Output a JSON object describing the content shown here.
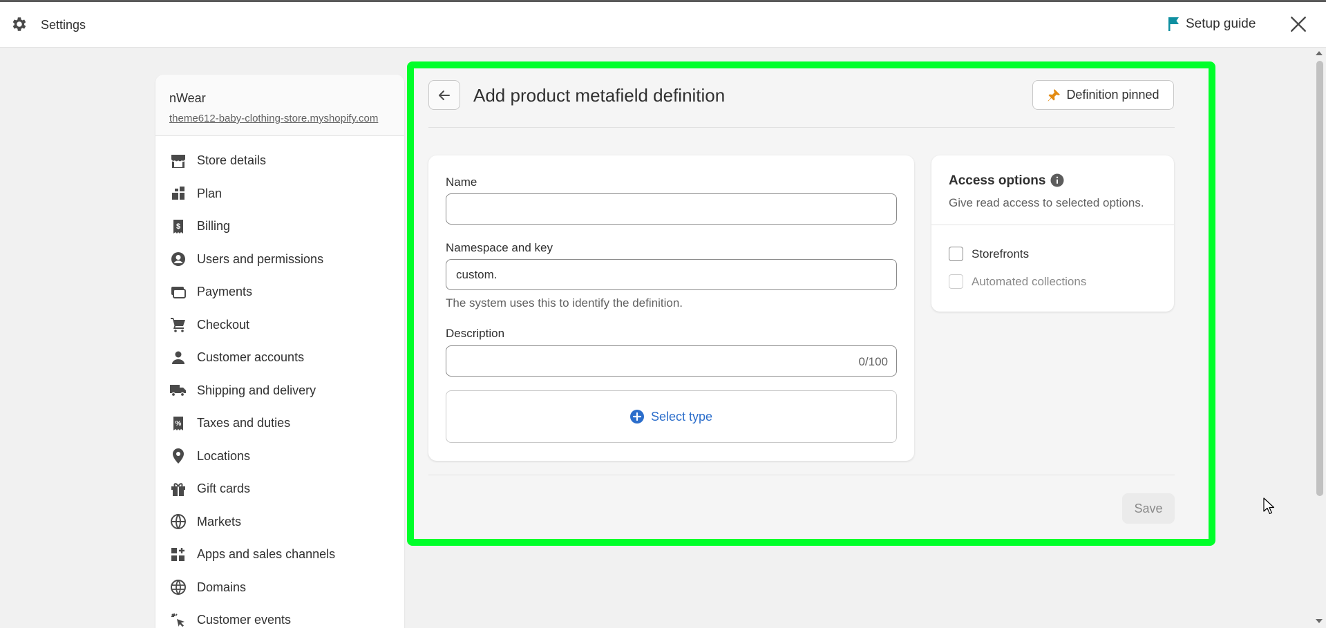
{
  "topbar": {
    "title": "Settings",
    "setup_guide_label": "Setup guide"
  },
  "store": {
    "name": "nWear",
    "url": "theme612-baby-clothing-store.myshopify.com"
  },
  "sidebar": {
    "items": [
      {
        "label": "Store details",
        "icon": "store-icon"
      },
      {
        "label": "Plan",
        "icon": "plan-icon"
      },
      {
        "label": "Billing",
        "icon": "billing-icon"
      },
      {
        "label": "Users and permissions",
        "icon": "user-circle-icon"
      },
      {
        "label": "Payments",
        "icon": "payments-icon"
      },
      {
        "label": "Checkout",
        "icon": "cart-icon"
      },
      {
        "label": "Customer accounts",
        "icon": "person-icon"
      },
      {
        "label": "Shipping and delivery",
        "icon": "truck-icon"
      },
      {
        "label": "Taxes and duties",
        "icon": "tax-receipt-icon"
      },
      {
        "label": "Locations",
        "icon": "location-pin-icon"
      },
      {
        "label": "Gift cards",
        "icon": "gift-icon"
      },
      {
        "label": "Markets",
        "icon": "globe-icon"
      },
      {
        "label": "Apps and sales channels",
        "icon": "apps-icon"
      },
      {
        "label": "Domains",
        "icon": "domain-globe-icon"
      },
      {
        "label": "Customer events",
        "icon": "cursor-click-icon"
      }
    ]
  },
  "main": {
    "title": "Add product metafield definition",
    "pinned_label": "Definition pinned",
    "form": {
      "name_label": "Name",
      "name_value": "",
      "namespace_label": "Namespace and key",
      "namespace_value": "custom.",
      "namespace_help": "The system uses this to identify the definition.",
      "description_label": "Description",
      "description_value": "",
      "description_counter": "0/100",
      "select_type_label": "Select type"
    },
    "access": {
      "title": "Access options",
      "subtitle": "Give read access to selected options.",
      "options": [
        {
          "label": "Storefronts",
          "disabled": false
        },
        {
          "label": "Automated collections",
          "disabled": true
        }
      ]
    },
    "save_label": "Save"
  },
  "colors": {
    "highlight": "#00ff2a",
    "link_blue": "#2c6ecb",
    "pin_orange": "#e38b12",
    "flag_teal": "#0e8fa0"
  }
}
